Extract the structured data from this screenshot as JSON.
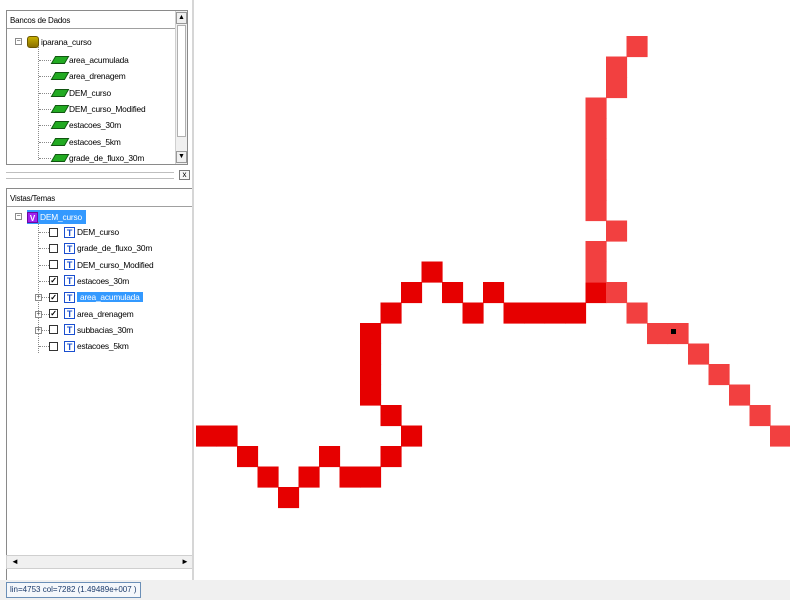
{
  "databases_panel": {
    "title": "Bancos de Dados",
    "database_name": "iparana_curso",
    "layers": [
      "area_acumulada",
      "area_drenagem",
      "DEM_curso",
      "DEM_curso_Modified",
      "estacoes_30m",
      "estacoes_5km",
      "grade_de_fluxo_30m"
    ]
  },
  "splitter": {
    "close_label": "x"
  },
  "views_panel": {
    "title": "Vistas/Temas",
    "view_name": "DEM_curso",
    "themes": [
      {
        "label": "DEM_curso",
        "checked": false,
        "expandable": false,
        "selected": false
      },
      {
        "label": "grade_de_fluxo_30m",
        "checked": false,
        "expandable": false,
        "selected": false
      },
      {
        "label": "DEM_curso_Modified",
        "checked": false,
        "expandable": false,
        "selected": false
      },
      {
        "label": "estacoes_30m",
        "checked": true,
        "expandable": false,
        "selected": false
      },
      {
        "label": "area_acumulada",
        "checked": true,
        "expandable": true,
        "selected": true
      },
      {
        "label": "area_drenagem",
        "checked": true,
        "expandable": true,
        "selected": false
      },
      {
        "label": "subbacias_30m",
        "checked": false,
        "expandable": true,
        "selected": false
      },
      {
        "label": "estacoes_5km",
        "checked": false,
        "expandable": false,
        "selected": false
      }
    ]
  },
  "status_bar": {
    "text": "lin=4753 col=7282 (1.49489e+007 )"
  },
  "colors": {
    "stream_dark": "#e60000",
    "stream_light": "#f24040",
    "selection": "#3399ff",
    "point": "#000000"
  },
  "icons": {
    "database": "database-icon",
    "layer": "raster-layer-icon",
    "view": "view-icon",
    "theme": "theme-icon",
    "checkbox": "checkbox-icon"
  }
}
